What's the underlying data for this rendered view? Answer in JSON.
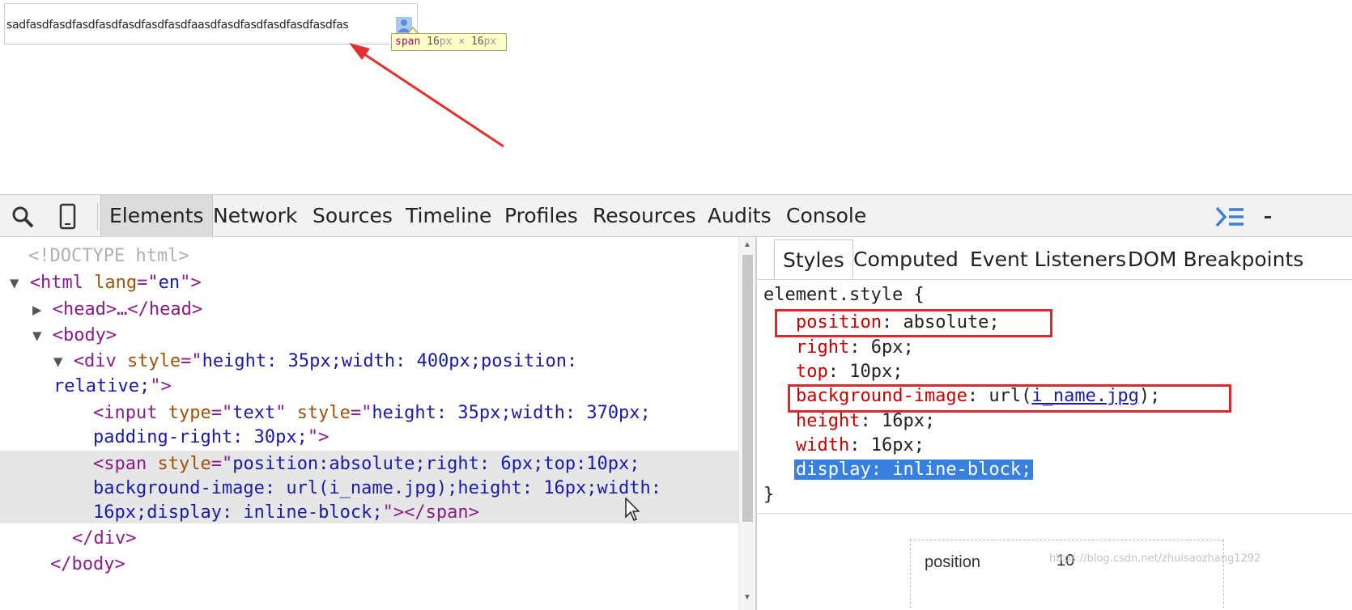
{
  "demo": {
    "input_text": "sadfasdfasdfasdfasdfasdfasdfasdfaasdfasdfasdfasdfasdfasdfas",
    "tooltip": {
      "tag": "span",
      "w": "16",
      "w_unit": "px",
      "times": "×",
      "h": "16",
      "h_unit": "px"
    }
  },
  "devtools": {
    "tabs": [
      "Elements",
      "Network",
      "Sources",
      "Timeline",
      "Profiles",
      "Resources",
      "Audits",
      "Console"
    ],
    "icons": [
      "search-icon",
      "device-mode-icon",
      "drawer-toggle-icon",
      "dock-icon"
    ],
    "dom": {
      "doctype": "<!DOCTYPE html>",
      "tri_open": "▼",
      "tri_closed": "▶",
      "html_tag": "<html ",
      "html_attr": "lang",
      "html_eq": "=\"",
      "html_val": "en",
      "html_close": "\">",
      "head_line": "<head>…</head>",
      "body_open": "<body>",
      "div_tag": "<div ",
      "div_attr": "style",
      "div_eq": "=\"",
      "div_val_1": "height: 35px;width: 400px;position:",
      "div_val_2": "relative;",
      "div_end": "\">",
      "input_tag": "<input ",
      "input_attr1": "type",
      "input_eq1": "=\"",
      "input_val1": "text",
      "input_q1": "\" ",
      "input_attr2": "style",
      "input_eq2": "=\"",
      "input_val2a": "height: 35px;width: 370px;",
      "input_val2b": "padding-right: 30px;",
      "input_end": "\">",
      "span_tag": "<span ",
      "span_attr": "style",
      "span_eq": "=\"",
      "span_val_1": "position:absolute;right: 6px;top:10px;",
      "span_val_2": "background-image: url(i_name.jpg);height: 16px;width:",
      "span_val_3": "16px;display: inline-block;",
      "span_end": "\"></span>",
      "div_close": "</div>",
      "body_close": "</body>"
    },
    "styles_tabs": [
      "Styles",
      "Computed",
      "Event Listeners",
      "DOM Breakpoints"
    ],
    "rule": {
      "selector": "element.style {",
      "decls": [
        {
          "prop": "position",
          "value": "absolute;"
        },
        {
          "prop": "right",
          "value": "6px;"
        },
        {
          "prop": "top",
          "value": "10px;"
        },
        {
          "prop": "background-image",
          "value_pre": "url(",
          "value_link": "i_name.jpg",
          "value_post": ");"
        },
        {
          "prop": "height",
          "value": "16px;"
        },
        {
          "prop": "width",
          "value": "16px;"
        }
      ],
      "selected_decl": "display: inline-block;",
      "close": "}",
      "sep": ": "
    },
    "box_model": {
      "label": "position",
      "value": "10"
    }
  },
  "watermark": "https://blog.csdn.net/zhuisaozhang1292",
  "colors": {
    "tag": "#8b1a8b",
    "attr": "#a0520a",
    "attr_value": "#1a1aa6",
    "css_prop": "#c80000",
    "highlight": "#3880e0",
    "annotation_red": "#e0262a"
  }
}
